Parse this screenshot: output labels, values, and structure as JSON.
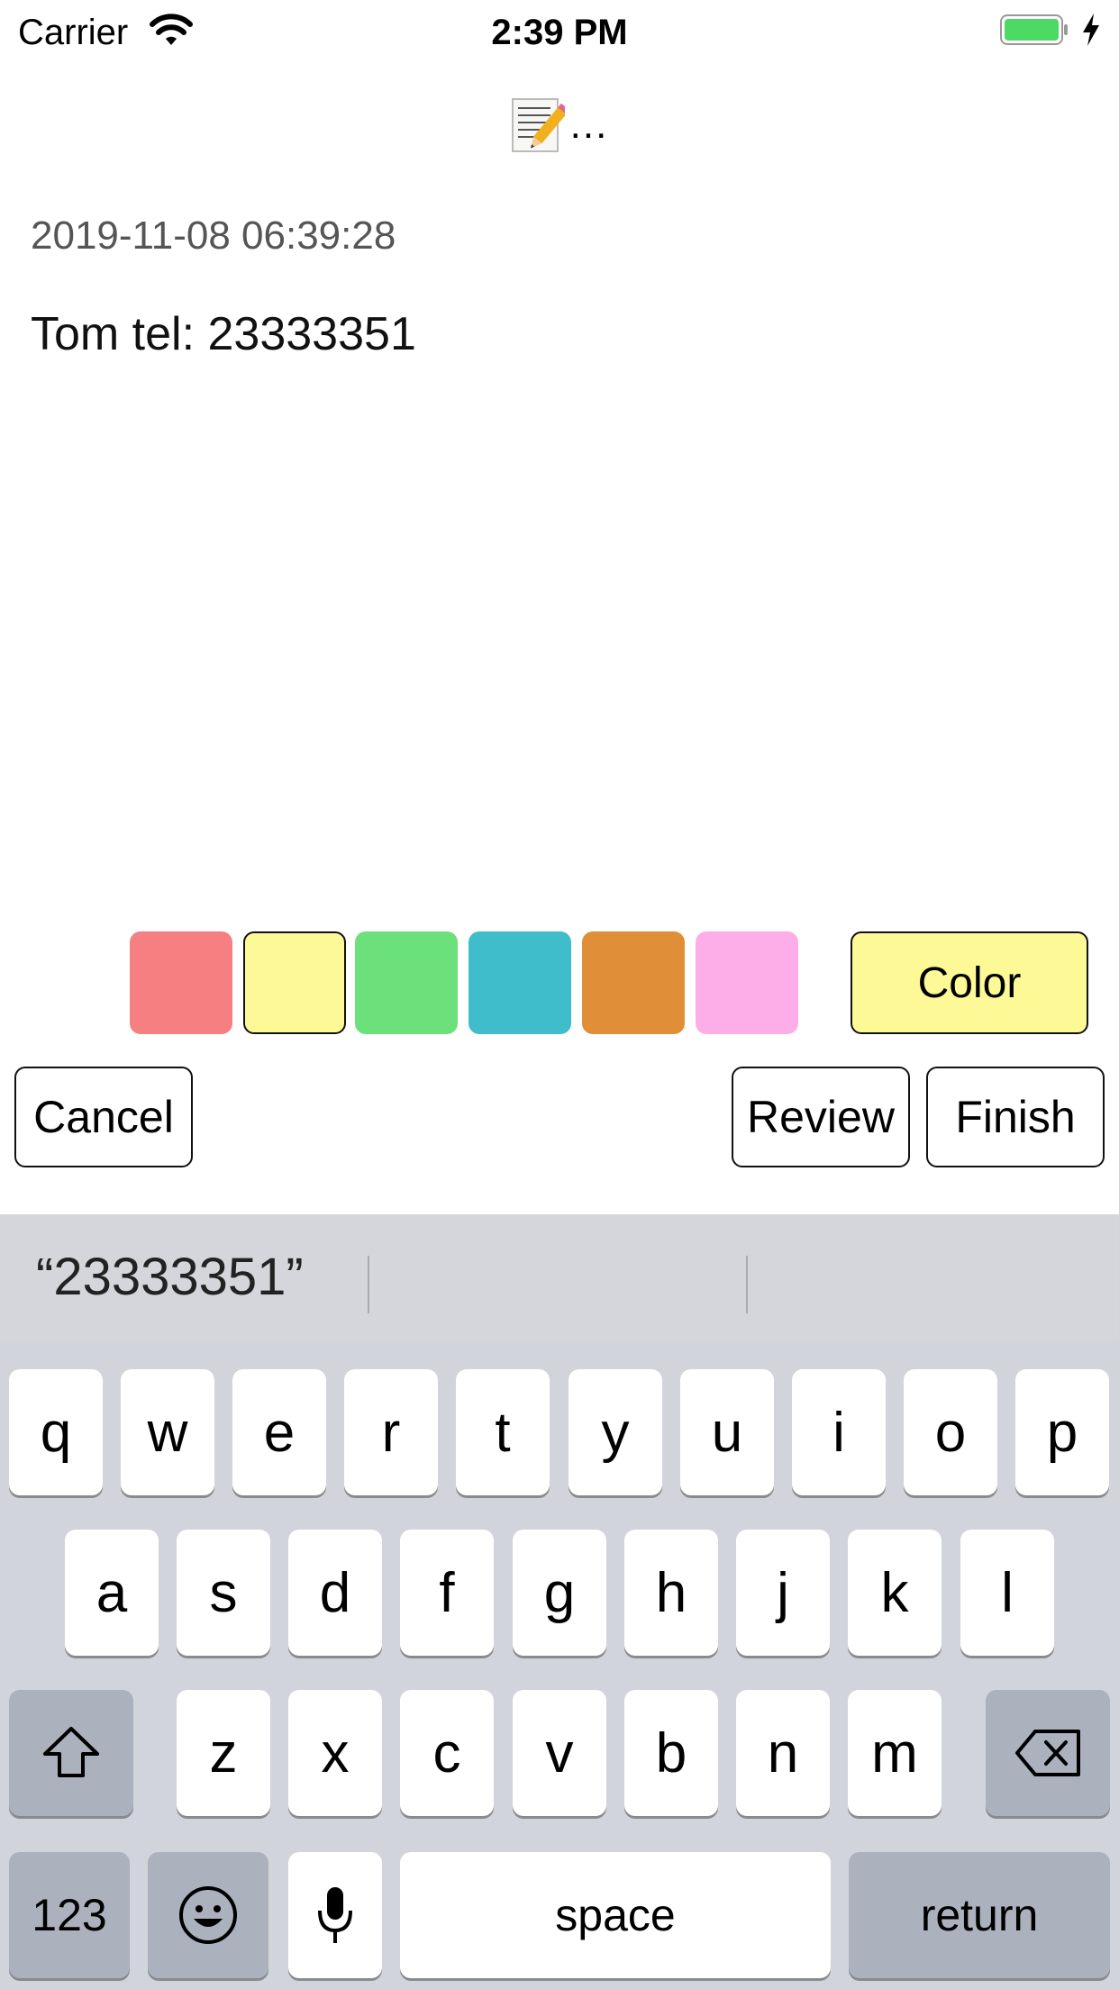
{
  "status_bar": {
    "carrier": "Carrier",
    "time": "2:39 PM"
  },
  "nav": {
    "title": "...",
    "icon": "memo-icon"
  },
  "note": {
    "date": "2019-11-08 06:39:28",
    "text": "Tom tel: 23333351"
  },
  "colors": {
    "swatches": [
      "#f57f81",
      "#fdf997",
      "#6be07b",
      "#40bdca",
      "#e18e39",
      "#fdaee9"
    ],
    "color_button_label": "Color",
    "selected_color": "#fdf997"
  },
  "actions": {
    "cancel": "Cancel",
    "review": "Review",
    "finish": "Finish"
  },
  "keyboard": {
    "prediction": "“23333351”",
    "row1": [
      "q",
      "w",
      "e",
      "r",
      "t",
      "y",
      "u",
      "i",
      "o",
      "p"
    ],
    "row2": [
      "a",
      "s",
      "d",
      "f",
      "g",
      "h",
      "j",
      "k",
      "l"
    ],
    "row3": [
      "z",
      "x",
      "c",
      "v",
      "b",
      "n",
      "m"
    ],
    "numbers_label": "123",
    "space_label": "space",
    "return_label": "return"
  }
}
